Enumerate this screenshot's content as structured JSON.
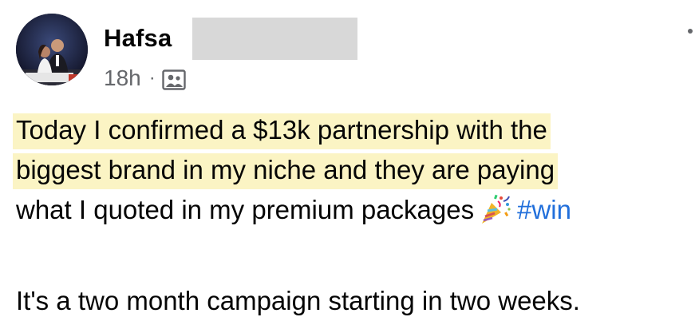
{
  "post": {
    "author": {
      "name": "Hafsa"
    },
    "meta": {
      "time": "18h",
      "separator": "·",
      "audience_icon": "photo-icon"
    },
    "text": {
      "line1": "Today I confirmed a $13k partnership with the",
      "line2": "biggest brand in my niche and they are paying",
      "line3": "what I quoted in my premium packages",
      "emoji": "party-popper-icon",
      "hashtag": "#win",
      "line4": "It's a two month campaign starting in two weeks."
    }
  },
  "colors": {
    "highlight": "#fbf4c4",
    "hashtag": "#216fdb",
    "meta_text": "#65676b",
    "redaction": "#d8d8d8"
  }
}
